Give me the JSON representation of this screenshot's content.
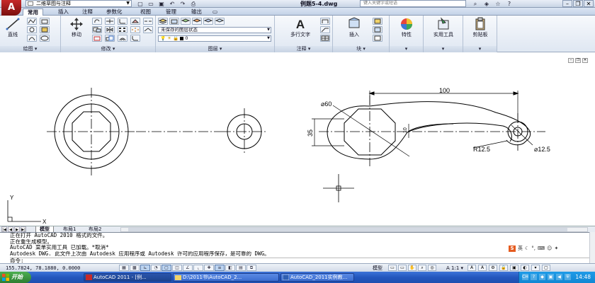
{
  "window": {
    "app_logo": "A",
    "workspace": "二维草图与注释",
    "document_title": "例题5-4.dwg",
    "search_placeholder": "键入关键字或短语",
    "quick_access_icons": [
      "new-icon",
      "open-icon",
      "save-icon",
      "undo-icon",
      "redo-icon",
      "plot-icon"
    ],
    "window_buttons": [
      "minimize-icon",
      "restore-icon",
      "close-icon"
    ]
  },
  "ribbon_tabs": [
    "常用",
    "插入",
    "注释",
    "参数化",
    "视图",
    "管理",
    "输出"
  ],
  "ribbon": {
    "draw": {
      "label": "绘图",
      "big_button": "直线"
    },
    "modify": {
      "label": "修改",
      "big_button": "移动"
    },
    "layers": {
      "label": "图层",
      "state_combo": "未保存的图层状态",
      "layer_combo": "0"
    },
    "annotation": {
      "label": "注释",
      "big_button": "多行文字"
    },
    "block": {
      "label": "块",
      "big_button": "插入"
    },
    "properties": {
      "big_button": "特性"
    },
    "utilities": {
      "big_button": "实用工具"
    },
    "clipboard": {
      "big_button": "剪贴板"
    }
  },
  "drawing": {
    "dimensions": [
      "100",
      "⌀60",
      "35",
      "10",
      "R12.5",
      "⌀12.5"
    ],
    "ucs_labels": [
      "Y",
      "X"
    ]
  },
  "layout_tabs": [
    "模型",
    "布局1",
    "布局2"
  ],
  "command_history": [
    "正在打开 AutoCAD 2010 格式的文件。",
    "正在重生成模型。",
    "AutoCAD 菜单实用工具 已加载。*取消*",
    "Autodesk DWG.   此文件上次由 Autodesk 应用程序或 Autodesk 许可的应用程序保存，是可靠的 DWG。"
  ],
  "command_prompt": "命令:",
  "ime": {
    "label": "英"
  },
  "statusbar": {
    "coords": "155.7824, 78.1880, 0.0000",
    "model_label": "模型",
    "scale": "A 1:1 ▾"
  },
  "taskbar": {
    "start_label": "开始",
    "items": [
      "AutoCAD 2011 - [例...",
      "D:\\2011书\\AutoCAD_2...",
      "AutoCAD_2011实例教..."
    ],
    "clock": "14:48"
  },
  "colors": {
    "title_gradient_top": "#e9eef7",
    "ribbon_bg": "#dfe7f2",
    "taskbar_blue": "#2356bd",
    "start_green": "#2e7d32",
    "ime_orange": "#e55b1f"
  }
}
